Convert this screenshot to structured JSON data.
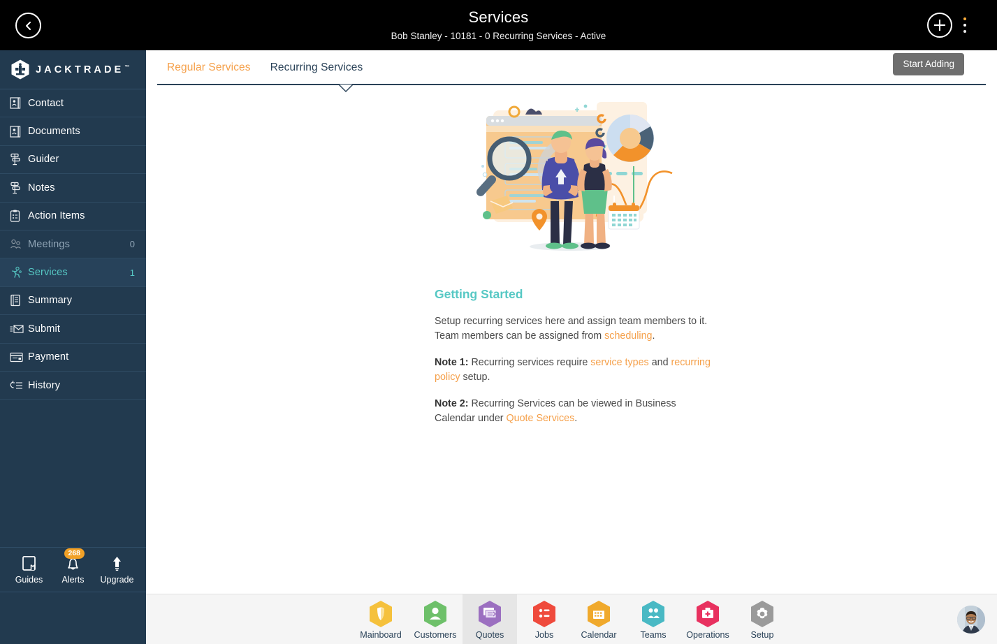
{
  "topbar": {
    "back_icon": "chevron-left-icon",
    "title": "Services",
    "subtitle": "Bob Stanley - 10181 - 0 Recurring Services - Active",
    "add_icon": "plus-icon",
    "menu_icon": "kebab-menu-icon"
  },
  "sidebar": {
    "logo_text": "JACKTRADE",
    "logo_tm": "™",
    "items": [
      {
        "label": "Contact",
        "icon": "contact-card-icon",
        "count": "",
        "state": "normal"
      },
      {
        "label": "Documents",
        "icon": "documents-icon",
        "count": "",
        "state": "normal"
      },
      {
        "label": "Guider",
        "icon": "guider-signpost-icon",
        "count": "",
        "state": "normal"
      },
      {
        "label": "Notes",
        "icon": "notes-signpost-icon",
        "count": "",
        "state": "normal"
      },
      {
        "label": "Action Items",
        "icon": "clipboard-list-icon",
        "count": "",
        "state": "normal"
      },
      {
        "label": "Meetings",
        "icon": "meetings-icon",
        "count": "0",
        "state": "dim"
      },
      {
        "label": "Services",
        "icon": "services-runner-icon",
        "count": "1",
        "state": "active"
      },
      {
        "label": "Summary",
        "icon": "summary-book-icon",
        "count": "",
        "state": "normal"
      },
      {
        "label": "Submit",
        "icon": "submit-envelope-icon",
        "count": "",
        "state": "normal"
      },
      {
        "label": "Payment",
        "icon": "payment-card-icon",
        "count": "",
        "state": "normal"
      },
      {
        "label": "History",
        "icon": "history-list-icon",
        "count": "",
        "state": "normal"
      }
    ],
    "utilities": [
      {
        "label": "Guides",
        "icon": "book-icon",
        "badge": ""
      },
      {
        "label": "Alerts",
        "icon": "bell-icon",
        "badge": "268"
      },
      {
        "label": "Upgrade",
        "icon": "up-arrow-icon",
        "badge": ""
      }
    ],
    "hex_shortcuts": [
      {
        "icon": "person-hex-icon"
      },
      {
        "icon": "dollar-hex-icon"
      },
      {
        "icon": "money-transfer-hex-icon"
      },
      {
        "icon": "workflow-hex-icon"
      }
    ]
  },
  "main": {
    "tabs": [
      {
        "label": "Regular Services",
        "active": true
      },
      {
        "label": "Recurring Services",
        "active": false
      }
    ],
    "start_adding_label": "Start Adding",
    "illustration_name": "team-analytics-illustration",
    "getting_started": {
      "title": "Getting Started",
      "p1_a": "Setup recurring services here and assign team members to it. Team members can be assigned from ",
      "p1_link": "scheduling",
      "p1_b": ".",
      "p2_label": "Note 1:",
      "p2_a": " Recurring services require ",
      "p2_link1": "service types",
      "p2_b": " and ",
      "p2_link2": "recurring policy",
      "p2_c": " setup.",
      "p3_label": "Note 2:",
      "p3_a": " Recurring Services can be viewed in Business Calendar under ",
      "p3_link": "Quote Services",
      "p3_b": "."
    }
  },
  "bottom_nav": {
    "items": [
      {
        "label": "Mainboard",
        "icon": "mainboard-hex-icon",
        "color": "#f5c13c",
        "selected": false
      },
      {
        "label": "Customers",
        "icon": "customers-hex-icon",
        "color": "#6ec06a",
        "selected": false
      },
      {
        "label": "Quotes",
        "icon": "quotes-hex-icon",
        "color": "#9b6fc0",
        "selected": true
      },
      {
        "label": "Jobs",
        "icon": "jobs-hex-icon",
        "color": "#ef4a3c",
        "selected": false
      },
      {
        "label": "Calendar",
        "icon": "calendar-hex-icon",
        "color": "#f0a92c",
        "selected": false
      },
      {
        "label": "Teams",
        "icon": "teams-hex-icon",
        "color": "#49b9c4",
        "selected": false
      },
      {
        "label": "Operations",
        "icon": "operations-hex-icon",
        "color": "#e8315f",
        "selected": false
      },
      {
        "label": "Setup",
        "icon": "setup-hex-icon",
        "color": "#9a9a9a",
        "selected": false
      }
    ],
    "avatar_icon": "user-avatar"
  },
  "colors": {
    "sidebar_bg": "#223a4f",
    "accent_orange": "#f5a04a",
    "accent_teal": "#56c8c4",
    "topbar_bg": "#000000",
    "badge_orange": "#f2a127"
  }
}
